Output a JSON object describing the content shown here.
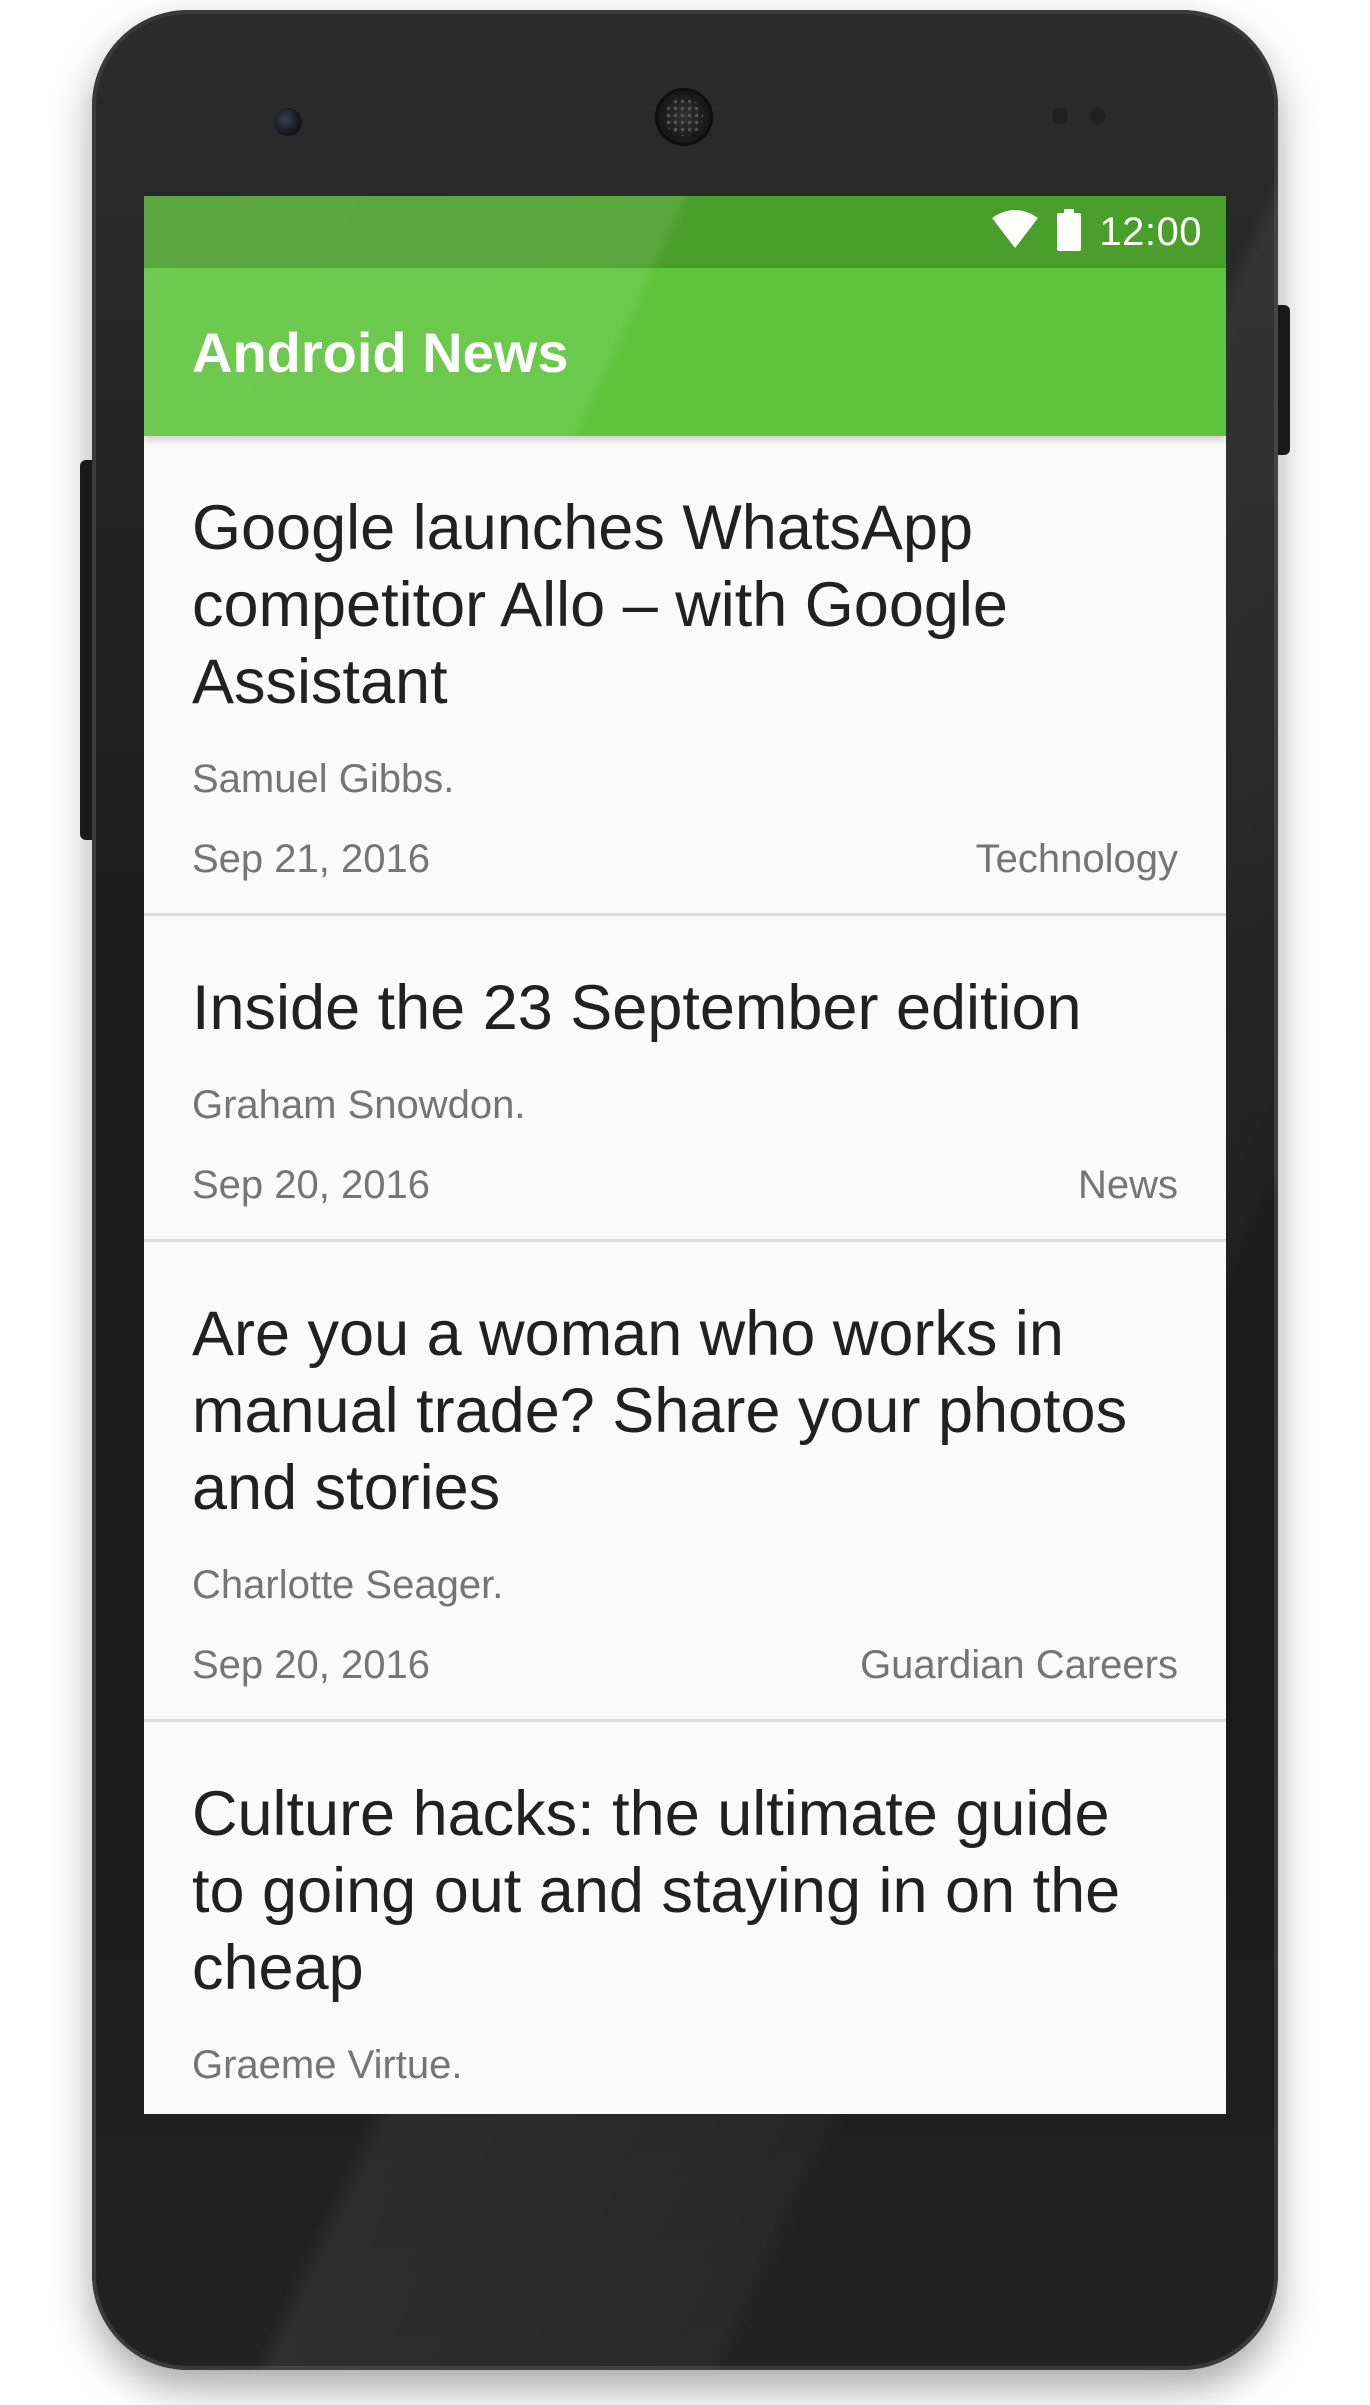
{
  "status_bar": {
    "time": "12:00",
    "icons": [
      "wifi-icon",
      "battery-icon"
    ]
  },
  "app_bar": {
    "title": "Android News",
    "color": "#5ec43c",
    "status_color": "#4a9e2c"
  },
  "articles": [
    {
      "title": "Google launches WhatsApp competitor Allo – with Google Assistant",
      "author": "Samuel Gibbs.",
      "date": "Sep 21, 2016",
      "section": "Technology"
    },
    {
      "title": "Inside the 23 September edition",
      "author": "Graham Snowdon.",
      "date": "Sep 20, 2016",
      "section": "News"
    },
    {
      "title": "Are you a woman who works in manual trade? Share your photos and stories",
      "author": "Charlotte Seager.",
      "date": "Sep 20, 2016",
      "section": "Guardian Careers"
    },
    {
      "title": "Culture hacks: the ultimate guide to going out and staying in on the cheap",
      "author": "Graeme Virtue.",
      "date": "",
      "section": ""
    }
  ]
}
